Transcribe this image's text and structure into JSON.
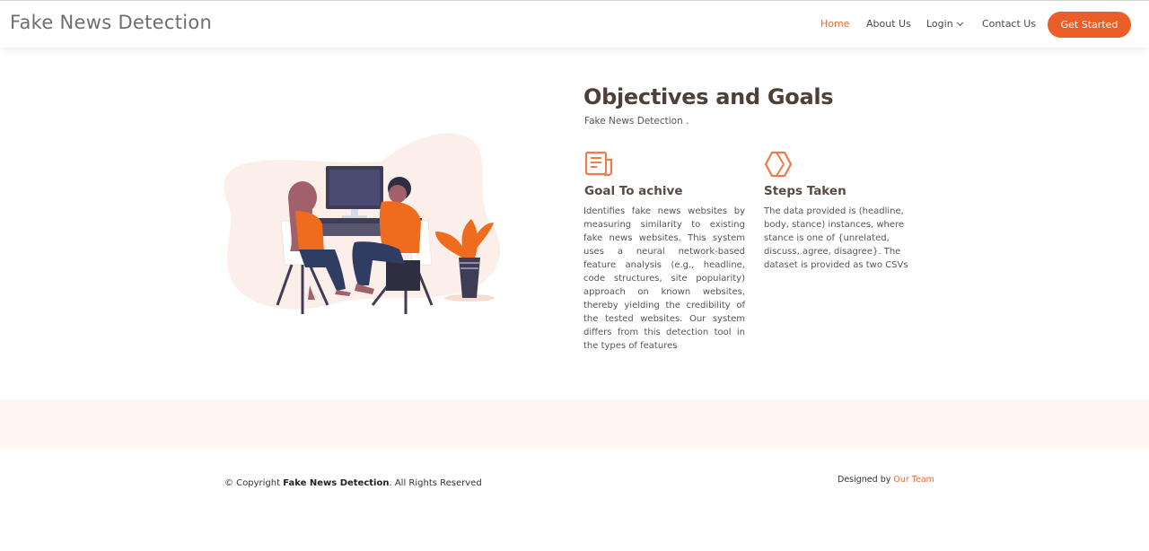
{
  "brand": {
    "title": "Fake News Detection"
  },
  "nav": {
    "items": [
      {
        "label": "Home",
        "active": true
      },
      {
        "label": "About Us",
        "active": false
      },
      {
        "label": "Login",
        "active": false,
        "has_dropdown": true
      },
      {
        "label": "Contact Us",
        "active": false
      }
    ],
    "cta_label": "Get Started"
  },
  "objectives": {
    "title": "Objectives and Goals",
    "subtitle": "Fake News Detection .",
    "features": [
      {
        "icon": "document-icon",
        "title": "Goal To achive",
        "text": "Identifies fake news websites by measuring similarity to existing fake news websites. This system uses a neural network-based feature analysis (e.g., headline, code structures, site popularity) approach on known websites, thereby yielding the credibility of the tested websites. Our system differs from this detection tool in the types of features"
      },
      {
        "icon": "hexagon-icon",
        "title": "Steps Taken",
        "text": "The data provided is (headline, body, stance) instances, where stance is one of {unrelated, discuss, agree, disagree}. The dataset is provided as two CSVs"
      }
    ]
  },
  "footer": {
    "copyright_prefix": "© Copyright ",
    "copyright_brand": "Fake News Detection",
    "copyright_suffix": ". All Rights Reserved",
    "credit_prefix": "Designed by ",
    "credit_link": "Our Team"
  },
  "colors": {
    "accent": "#eb5e28",
    "heading": "#4e3f39",
    "band": "#fef6f2"
  }
}
